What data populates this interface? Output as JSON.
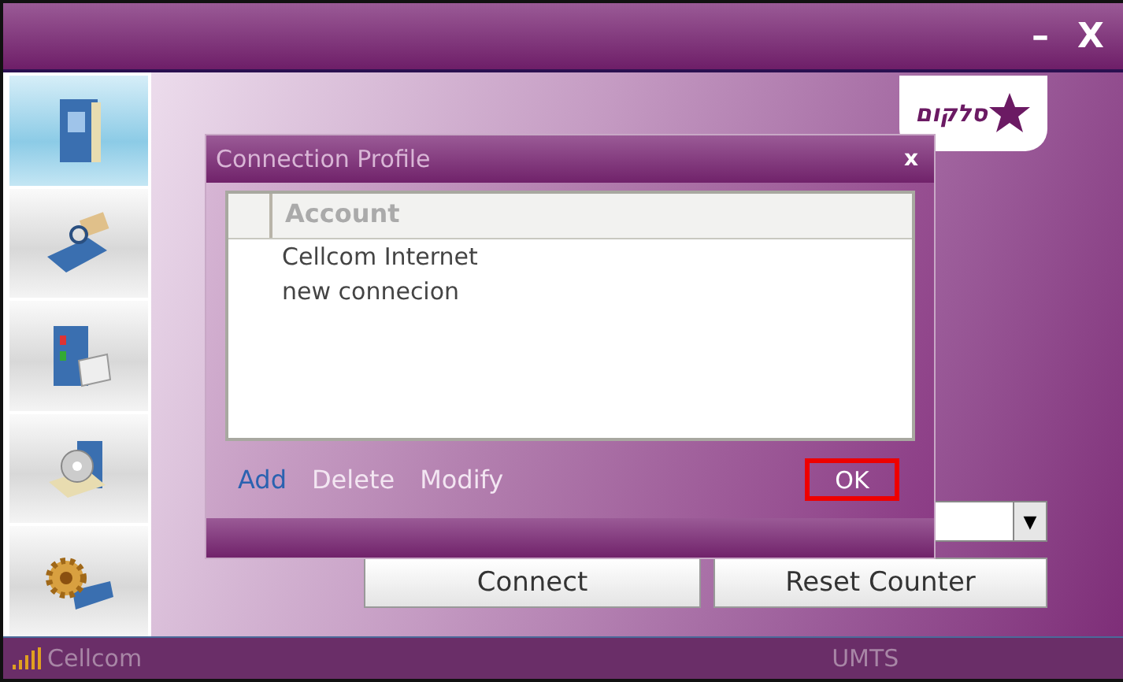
{
  "window": {
    "minimize": "–",
    "close": "X"
  },
  "sidebar": {
    "items": [
      {
        "selected": true
      },
      {
        "selected": false
      },
      {
        "selected": false
      },
      {
        "selected": false
      },
      {
        "selected": false
      }
    ]
  },
  "logo": {
    "text": "סלקום"
  },
  "main": {
    "dropdown": {
      "arrow": "▼"
    },
    "buttons": [
      "Connect",
      "Reset Counter"
    ]
  },
  "dialog": {
    "title": "Connection Profile",
    "close": "x",
    "columns": [
      "Account"
    ],
    "rows": [
      "Cellcom Internet",
      "new connecion"
    ],
    "actions": [
      {
        "label": "Add",
        "disabled": false
      },
      {
        "label": "Delete",
        "disabled": true
      },
      {
        "label": "Modify",
        "disabled": true
      }
    ],
    "ok": "OK"
  },
  "status_bar": {
    "operator": "Cellcom",
    "network": "UMTS"
  }
}
